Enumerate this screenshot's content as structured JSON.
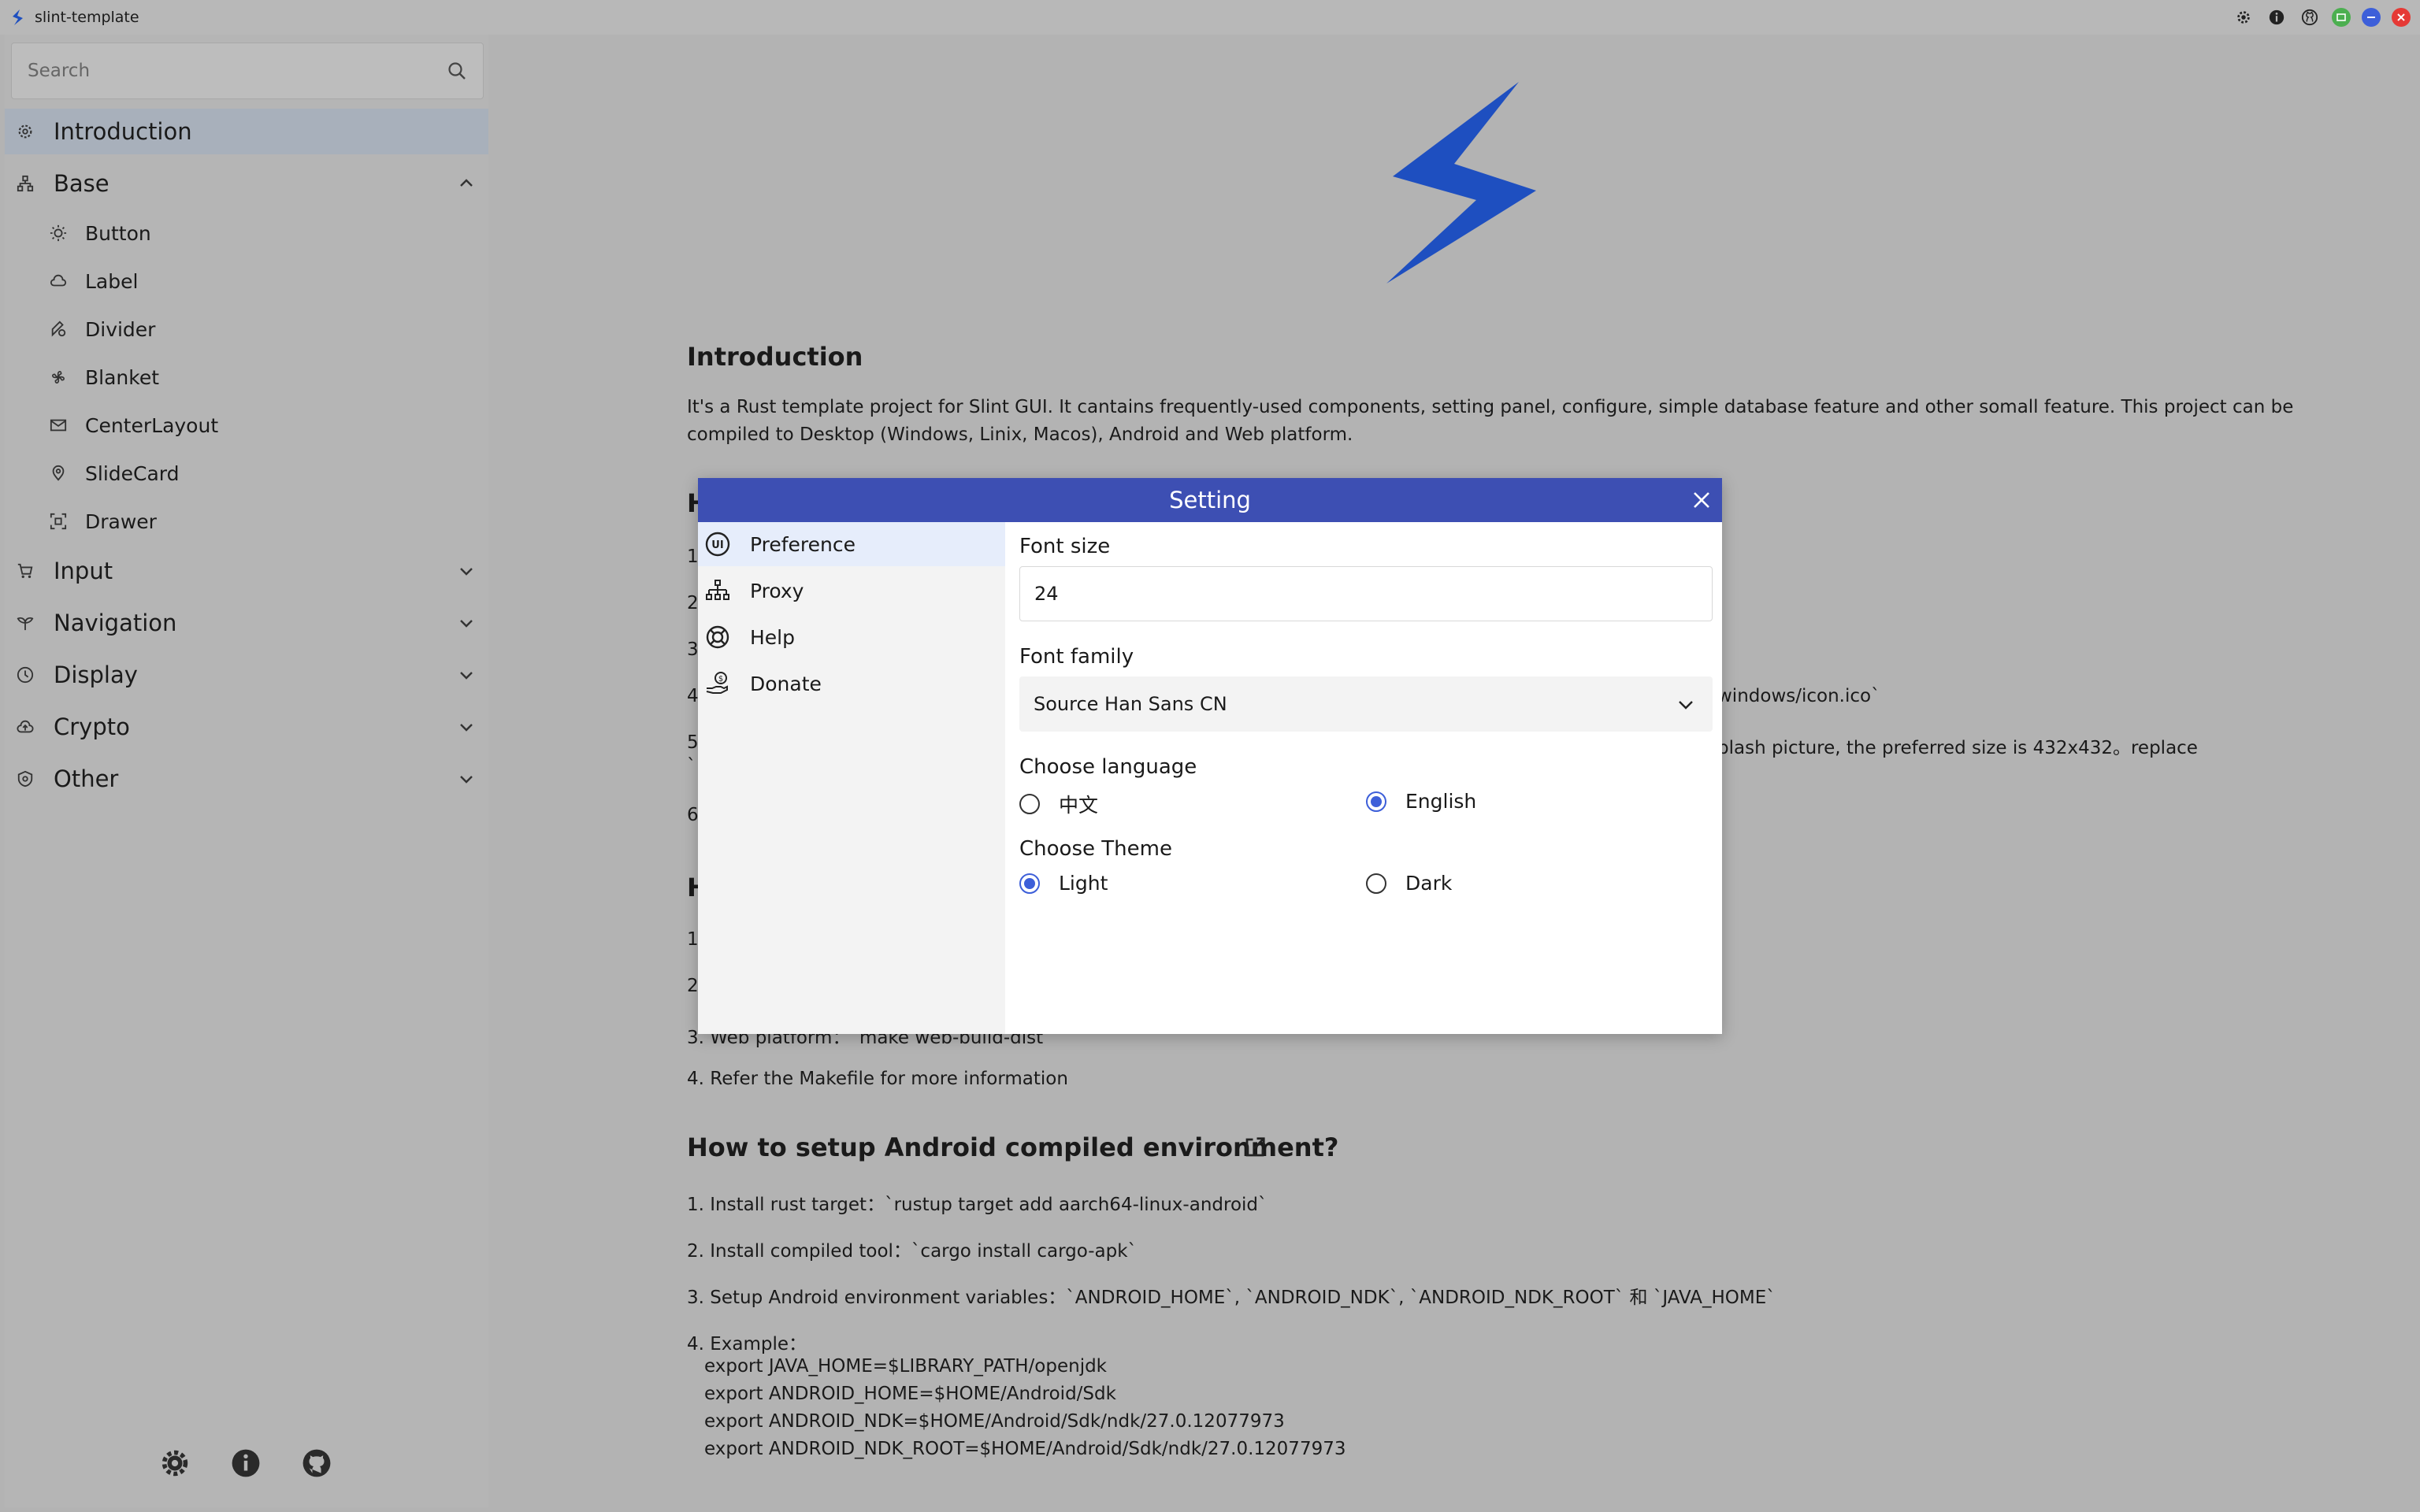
{
  "window": {
    "title": "slint-template",
    "titlebar_icons": [
      "gear-icon",
      "info-icon",
      "github-icon"
    ],
    "window_controls": [
      "maximize-icon",
      "minimize-icon",
      "close-icon"
    ]
  },
  "colors": {
    "accent": "#3d4fb3",
    "logo": "#1e4fc0",
    "radio": "#3d5fd9",
    "active_nav": "#a8b0bb",
    "ctrl_green": "#4caf50",
    "ctrl_blue": "#3d5fd9",
    "ctrl_red": "#e53935"
  },
  "sidebar": {
    "search_placeholder": "Search",
    "items": [
      {
        "label": "Introduction",
        "icon": "gear-icon",
        "active": true
      },
      {
        "label": "Base",
        "icon": "tree-icon",
        "expanded": true,
        "children": [
          {
            "label": "Button",
            "icon": "sun-icon"
          },
          {
            "label": "Label",
            "icon": "cloud-icon"
          },
          {
            "label": "Divider",
            "icon": "pen-icon"
          },
          {
            "label": "Blanket",
            "icon": "fan-icon"
          },
          {
            "label": "CenterLayout",
            "icon": "mail-icon"
          },
          {
            "label": "SlideCard",
            "icon": "pin-icon"
          },
          {
            "label": "Drawer",
            "icon": "scan-icon"
          }
        ]
      },
      {
        "label": "Input",
        "icon": "cart-icon",
        "expanded": false
      },
      {
        "label": "Navigation",
        "icon": "plant-icon",
        "expanded": false
      },
      {
        "label": "Display",
        "icon": "clock-icon",
        "expanded": false
      },
      {
        "label": "Crypto",
        "icon": "cloud-upload-icon",
        "expanded": false
      },
      {
        "label": "Other",
        "icon": "shield-icon",
        "expanded": false
      }
    ],
    "footer_icons": [
      "settings-icon",
      "info-icon",
      "github-icon"
    ]
  },
  "main": {
    "intro_heading": "Introduction",
    "intro_text": "It's a Rust template project for Slint GUI. It cantains frequently-used components, setting panel, configure, simple database feature and other somall feature. This project can be compiled to Desktop (Windows, Linix, Macos), Android and Web platform.",
    "partial_heading_1": "H",
    "partial_lines_1": [
      "1",
      "2",
      "3",
      "4",
      "5",
      "`",
      "6"
    ],
    "partial_line_4_tail": "windows/icon.ico`",
    "partial_line_5_tail": "plash picture, the preferred size is 432x432。replace",
    "partial_heading_2": "H",
    "partial_lines_2": [
      "1",
      "2"
    ],
    "build_line_3": "3. Web platform：`make web-build-dist`",
    "build_line_4": "4. Refer the Makefile for more information",
    "android_heading": "How to setup Android compiled environment?",
    "android_lines": [
      "1. Install rust target：`rustup target add aarch64-linux-android`",
      "2. Install compiled tool：`cargo install cargo-apk`",
      "3. Setup Android environment variables：`ANDROID_HOME`, `ANDROID_NDK`, `ANDROID_NDK_ROOT` 和 `JAVA_HOME`",
      "4. Example："
    ],
    "android_example": [
      "export JAVA_HOME=$LIBRARY_PATH/openjdk",
      "export ANDROID_HOME=$HOME/Android/Sdk",
      "export ANDROID_NDK=$HOME/Android/Sdk/ndk/27.0.12077973",
      "export ANDROID_NDK_ROOT=$HOME/Android/Sdk/ndk/27.0.12077973"
    ]
  },
  "setting_dialog": {
    "title": "Setting",
    "nav": [
      {
        "label": "Preference",
        "icon": "ui-icon",
        "active": true
      },
      {
        "label": "Proxy",
        "icon": "network-icon"
      },
      {
        "label": "Help",
        "icon": "lifebuoy-icon"
      },
      {
        "label": "Donate",
        "icon": "donate-icon"
      }
    ],
    "font_size_label": "Font size",
    "font_size_value": "24",
    "font_family_label": "Font family",
    "font_family_value": "Source Han Sans CN",
    "language_label": "Choose language",
    "language_options": [
      "中文",
      "English"
    ],
    "language_selected": "English",
    "theme_label": "Choose Theme",
    "theme_options": [
      "Light",
      "Dark"
    ],
    "theme_selected": "Light"
  }
}
